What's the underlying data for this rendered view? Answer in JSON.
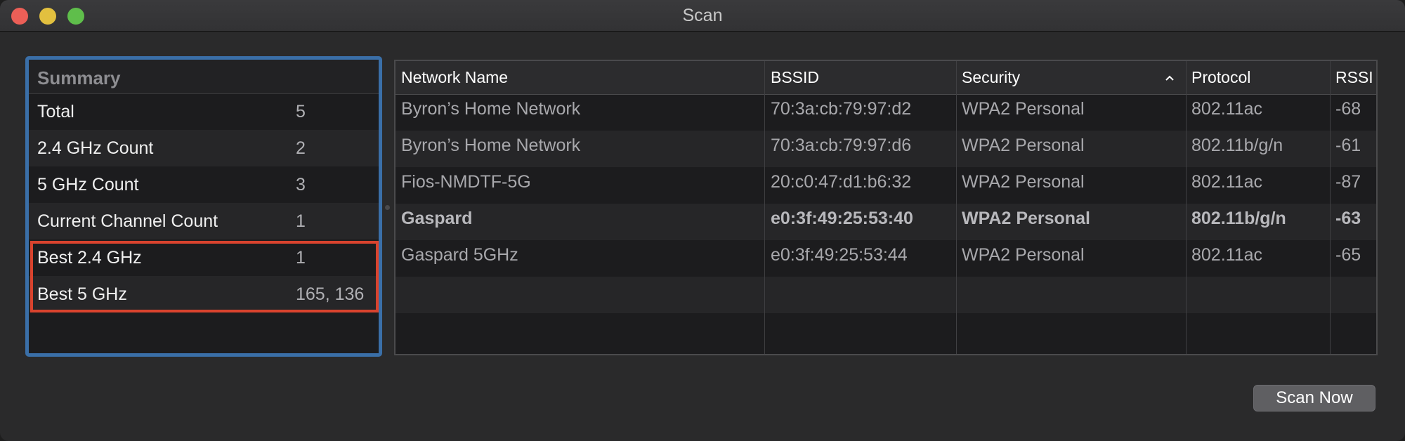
{
  "window": {
    "title": "Scan"
  },
  "summary": {
    "header": "Summary",
    "rows": [
      {
        "label": "Total",
        "value": "5"
      },
      {
        "label": "2.4 GHz Count",
        "value": "2"
      },
      {
        "label": "5 GHz Count",
        "value": "3"
      },
      {
        "label": "Current Channel Count",
        "value": "1"
      },
      {
        "label": "Best 2.4 GHz",
        "value": "1"
      },
      {
        "label": "Best 5 GHz",
        "value": "165, 136"
      }
    ]
  },
  "table": {
    "columns": [
      "Network Name",
      "BSSID",
      "Security",
      "Protocol",
      "RSSI"
    ],
    "sorted_column": "Security",
    "sort_direction": "ascending",
    "rows": [
      {
        "name": "Byron’s Home Network",
        "bssid": "70:3a:cb:79:97:d2",
        "security": "WPA2 Personal",
        "protocol": "802.11ac",
        "rssi": "-68"
      },
      {
        "name": "Byron’s Home Network",
        "bssid": "70:3a:cb:79:97:d6",
        "security": "WPA2 Personal",
        "protocol": "802.11b/g/n",
        "rssi": "-61"
      },
      {
        "name": "Fios-NMDTF-5G",
        "bssid": "20:c0:47:d1:b6:32",
        "security": "WPA2 Personal",
        "protocol": "802.11ac",
        "rssi": "-87"
      },
      {
        "name": "Gaspard",
        "bssid": "e0:3f:49:25:53:40",
        "security": "WPA2 Personal",
        "protocol": "802.11b/g/n",
        "rssi": "-63"
      },
      {
        "name": "Gaspard 5GHz",
        "bssid": "e0:3f:49:25:53:44",
        "security": "WPA2 Personal",
        "protocol": "802.11ac",
        "rssi": "-65"
      }
    ]
  },
  "actions": {
    "scan_now": "Scan Now"
  },
  "colors": {
    "summary_border": "#3a6fa8",
    "highlight_border": "#d9432e"
  }
}
